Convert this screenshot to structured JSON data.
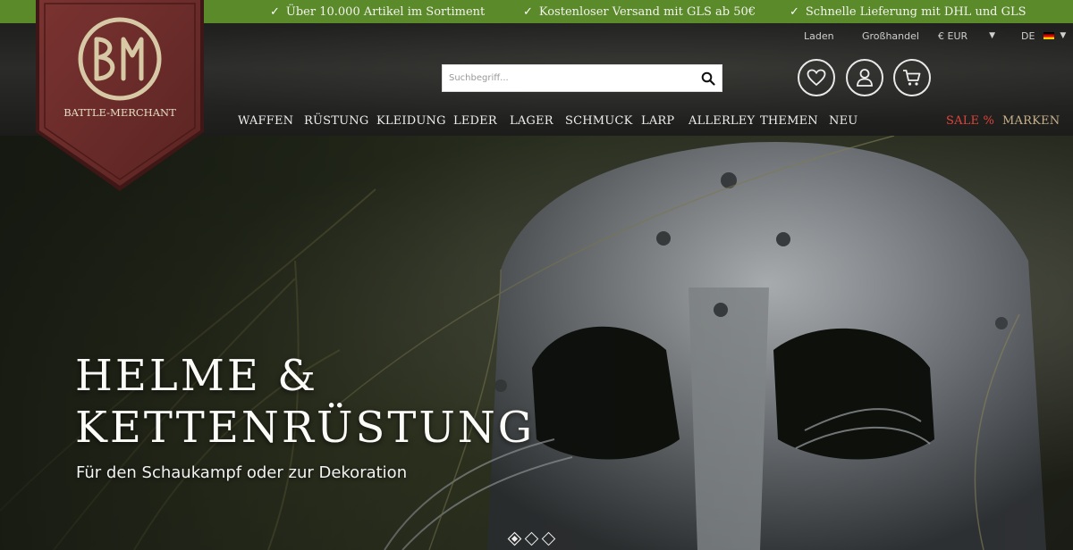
{
  "usps": [
    {
      "icon": "check-icon",
      "text": "Über 10.000 Artikel im Sortiment"
    },
    {
      "icon": "check-icon",
      "text": "Kostenloser Versand mit GLS ab 50€"
    },
    {
      "icon": "check-icon",
      "text": "Schnelle Lieferung mit DHL und GLS"
    }
  ],
  "meta": {
    "store": "Laden",
    "wholesale": "Großhandel",
    "currency": "€ EUR",
    "language": "DE"
  },
  "logo": {
    "monogram": "BM",
    "name": "BATTLE-MERCHANT"
  },
  "search": {
    "placeholder": "Suchbegriff..."
  },
  "icons": {
    "wishlist": "heart-icon",
    "account": "user-icon",
    "cart": "cart-icon",
    "search": "search-icon"
  },
  "nav": {
    "items": [
      "WAFFEN",
      "RÜSTUNG",
      "KLEIDUNG",
      "LEDER",
      "LAGER",
      "SCHMUCK",
      "LARP",
      "ALLERLEY",
      "THEMEN",
      "NEU"
    ],
    "sale": "SALE %",
    "brands": "MARKEN"
  },
  "hero": {
    "title_line1": "HELME &",
    "title_line2": "KETTENRÜSTUNG",
    "subtitle": "Für den Schaukampf oder zur Dekoration",
    "slides_total": 3,
    "active_slide": 1
  },
  "colors": {
    "topbar": "#5a8a2a",
    "banner": "#6e2e2c",
    "sale": "#e0443a",
    "brands": "#c9b28a",
    "logo_gold": "#d8c9a6"
  }
}
